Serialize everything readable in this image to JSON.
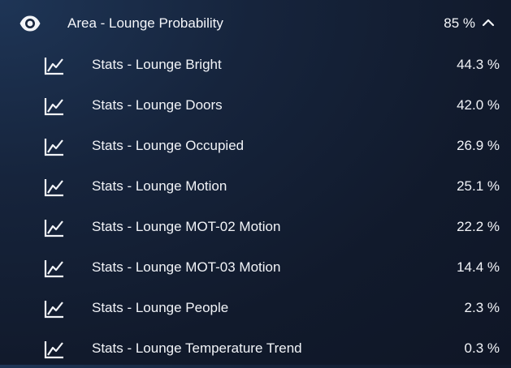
{
  "header": {
    "icon": "eye-icon",
    "title": "Area - Lounge Probability",
    "value": "85 %",
    "toggle_icon": "chevron-up-icon"
  },
  "rows": [
    {
      "icon": "chart-line-icon",
      "label": "Stats - Lounge Bright",
      "value": "44.3 %"
    },
    {
      "icon": "chart-line-icon",
      "label": "Stats - Lounge Doors",
      "value": "42.0 %"
    },
    {
      "icon": "chart-line-icon",
      "label": "Stats - Lounge Occupied",
      "value": "26.9 %"
    },
    {
      "icon": "chart-line-icon",
      "label": "Stats - Lounge Motion",
      "value": "25.1 %"
    },
    {
      "icon": "chart-line-icon",
      "label": "Stats - Lounge MOT-02 Motion",
      "value": "22.2 %"
    },
    {
      "icon": "chart-line-icon",
      "label": "Stats - Lounge MOT-03 Motion",
      "value": "14.4 %"
    },
    {
      "icon": "chart-line-icon",
      "label": "Stats - Lounge People",
      "value": "2.3 %"
    },
    {
      "icon": "chart-line-icon",
      "label": "Stats - Lounge Temperature Trend",
      "value": "0.3 %"
    }
  ]
}
